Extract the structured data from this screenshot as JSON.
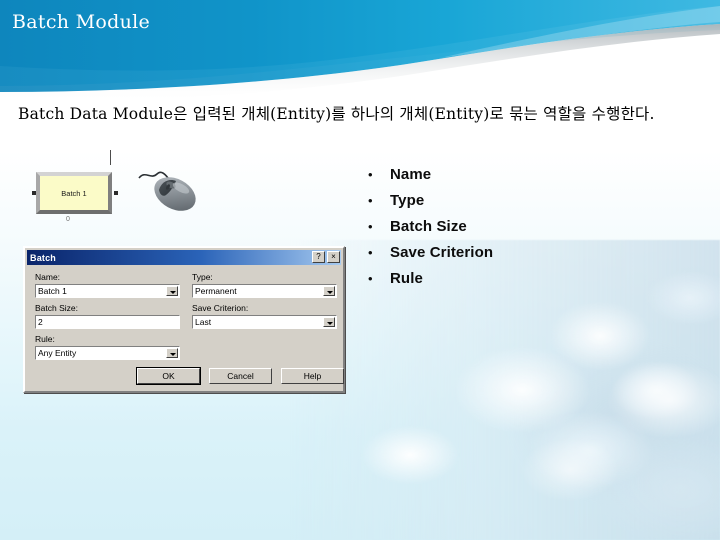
{
  "slide": {
    "title": "Batch Module",
    "body_text": "Batch Data Module은 입력된 개체(Entity)를 하나의 개체(Entity)로 묶는 역할을 수행한다.",
    "accent_color": "#0f8ec4",
    "accent_light": "#4ec0e4",
    "title_color": "#ffffff"
  },
  "diagram": {
    "module_label": "Batch 1",
    "caption": "0",
    "mouse_icon": "computer-mouse-icon"
  },
  "bullets": {
    "marker": "•",
    "items": [
      {
        "label": "Name"
      },
      {
        "label": "Type"
      },
      {
        "label": "Batch Size"
      },
      {
        "label": "Save Criterion"
      },
      {
        "label": "Rule"
      }
    ]
  },
  "dialog": {
    "title": "Batch",
    "help_button": "?",
    "close_button": "×",
    "fields": {
      "name": {
        "label": "Name:",
        "value": "Batch 1"
      },
      "type": {
        "label": "Type:",
        "value": "Permanent"
      },
      "batch_size": {
        "label": "Batch Size:",
        "value": "2"
      },
      "save_criterion": {
        "label": "Save Criterion:",
        "value": "Last"
      },
      "rule": {
        "label": "Rule:",
        "value": "Any Entity"
      }
    },
    "buttons": {
      "ok": "OK",
      "cancel": "Cancel",
      "help": "Help"
    }
  }
}
